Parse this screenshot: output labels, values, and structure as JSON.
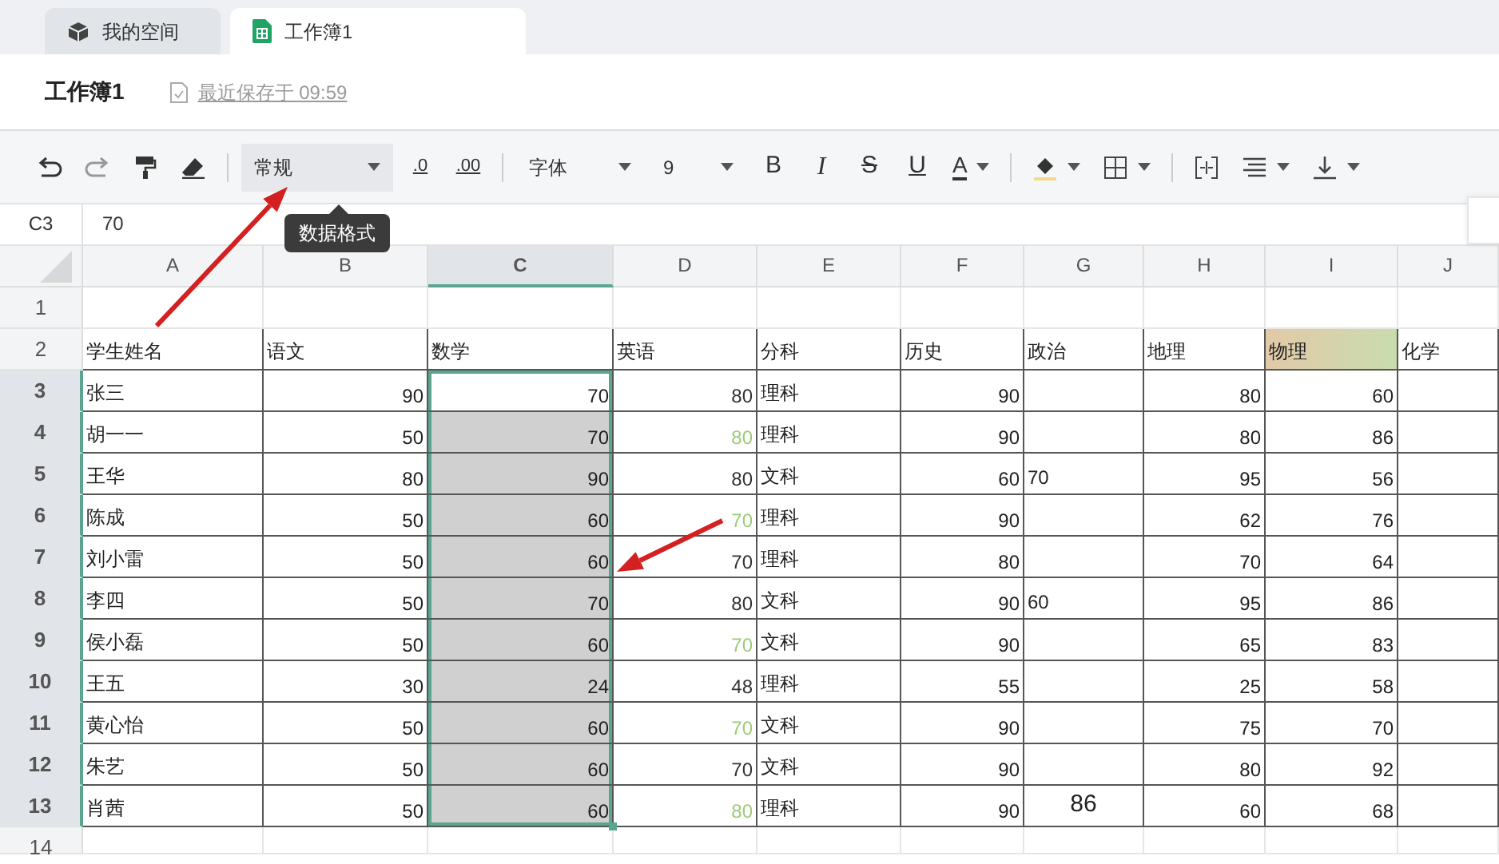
{
  "app_tabs": [
    {
      "label": "我的空间",
      "selected": false
    },
    {
      "label": "工作簿1",
      "selected": true
    }
  ],
  "document": {
    "title": "工作簿1",
    "save_status": "最近保存于 09:59"
  },
  "toolbar": {
    "number_format": "常规",
    "decrease_decimal": ".0",
    "increase_decimal": ".00",
    "font": "字体",
    "font_size": "9",
    "bold": "B",
    "italic": "I",
    "strikethrough": "S",
    "underline": "U",
    "font_color": "A"
  },
  "tooltip": "数据格式",
  "formula_bar": {
    "cell_ref": "C3",
    "value": "70"
  },
  "columns": [
    {
      "label": "A",
      "selected": false
    },
    {
      "label": "B",
      "selected": false
    },
    {
      "label": "C",
      "selected": true
    },
    {
      "label": "D",
      "selected": false
    },
    {
      "label": "E",
      "selected": false
    },
    {
      "label": "F",
      "selected": false
    },
    {
      "label": "G",
      "selected": false
    },
    {
      "label": "H",
      "selected": false
    },
    {
      "label": "I",
      "selected": false
    },
    {
      "label": "J",
      "selected": false
    }
  ],
  "rows": [
    {
      "number": "1",
      "selected": false,
      "cells": [
        null,
        null,
        null,
        null,
        null,
        null,
        null,
        null,
        null,
        null
      ]
    },
    {
      "number": "2",
      "selected": false,
      "cells": [
        {
          "text": "学生姓名",
          "highlighted": false
        },
        {
          "text": "语文",
          "highlighted": false
        },
        {
          "text": "数学",
          "highlighted": false
        },
        {
          "text": "英语",
          "highlighted": false
        },
        {
          "text": "分科",
          "highlighted": false
        },
        {
          "text": "历史",
          "highlighted": false
        },
        {
          "text": "政治",
          "highlighted": false
        },
        {
          "text": "地理",
          "highlighted": false
        },
        {
          "text": "物理",
          "highlighted": true
        },
        {
          "text": "化学",
          "highlighted": false
        }
      ]
    },
    {
      "number": "3",
      "selected": true,
      "cells": [
        "张三",
        "90",
        "70",
        {
          "text": "80",
          "color": "#333333"
        },
        "理科",
        "90",
        null,
        "80",
        "60",
        null
      ]
    },
    {
      "number": "4",
      "selected": true,
      "cells": [
        "胡一一",
        "50",
        "70",
        {
          "text": "80",
          "color": "#9ccc7a"
        },
        "理科",
        "90",
        null,
        "80",
        "86",
        null
      ]
    },
    {
      "number": "5",
      "selected": true,
      "cells": [
        "王华",
        "80",
        "90",
        {
          "text": "80",
          "color": "#333333"
        },
        "文科",
        "60",
        {
          "text": "70",
          "kind": "raised"
        },
        "95",
        "56",
        null
      ]
    },
    {
      "number": "6",
      "selected": true,
      "cells": [
        "陈成",
        "50",
        "60",
        {
          "text": "70",
          "color": "#9ccc7a"
        },
        "理科",
        "90",
        null,
        "62",
        "76",
        null
      ]
    },
    {
      "number": "7",
      "selected": true,
      "cells": [
        "刘小雷",
        "50",
        "60",
        {
          "text": "70",
          "color": "#333333"
        },
        "理科",
        "80",
        null,
        "70",
        "64",
        null
      ]
    },
    {
      "number": "8",
      "selected": true,
      "cells": [
        "李四",
        "50",
        "70",
        {
          "text": "80",
          "color": "#333333"
        },
        "文科",
        "90",
        {
          "text": "60",
          "kind": "raised"
        },
        "95",
        "86",
        null
      ]
    },
    {
      "number": "9",
      "selected": true,
      "cells": [
        "侯小磊",
        "50",
        "60",
        {
          "text": "70",
          "color": "#9ccc7a"
        },
        "文科",
        "90",
        null,
        "65",
        "83",
        null
      ]
    },
    {
      "number": "10",
      "selected": true,
      "cells": [
        "王五",
        "30",
        "24",
        {
          "text": "48",
          "color": "#333333"
        },
        "理科",
        "55",
        null,
        "25",
        "58",
        null
      ]
    },
    {
      "number": "11",
      "selected": true,
      "cells": [
        "黄心怡",
        "50",
        "60",
        {
          "text": "70",
          "color": "#9ccc7a"
        },
        "文科",
        "90",
        null,
        "75",
        "70",
        null
      ]
    },
    {
      "number": "12",
      "selected": true,
      "cells": [
        "朱艺",
        "50",
        "60",
        {
          "text": "70",
          "color": "#333333"
        },
        "文科",
        "90",
        null,
        "80",
        "92",
        null
      ]
    },
    {
      "number": "13",
      "selected": true,
      "cells": [
        "肖茜",
        "50",
        "60",
        {
          "text": "80",
          "color": "#9ccc7a"
        },
        "理科",
        "90",
        {
          "text": "86",
          "kind": "large"
        },
        "60",
        "68",
        null
      ]
    },
    {
      "number": "14",
      "selected": false,
      "cells": [
        null,
        null,
        null,
        null,
        null,
        null,
        null,
        null,
        null,
        null
      ]
    }
  ]
}
